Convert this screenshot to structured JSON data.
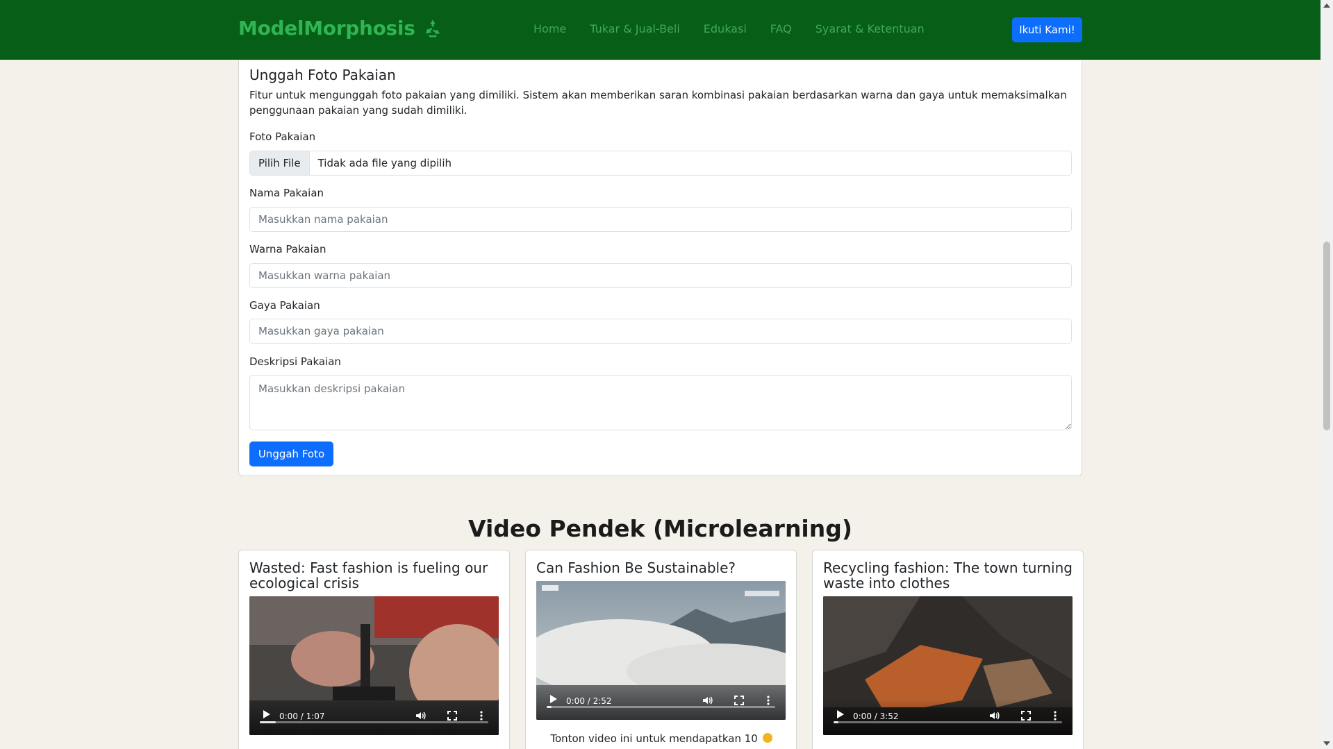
{
  "nav": {
    "brand": "ModelMorphosis",
    "links": [
      "Home",
      "Tukar & Jual-Beli",
      "Edukasi",
      "FAQ",
      "Syarat & Ketentuan"
    ],
    "cta": "Ikuti Kami!",
    "colors": {
      "background": "#075e16",
      "brand": "#2fb553",
      "link": "#41a75c",
      "cta": "#0d6efd"
    }
  },
  "upload": {
    "title": "Unggah Foto Pakaian",
    "description": "Fitur untuk mengunggah foto pakaian yang dimiliki. Sistem akan memberikan saran kombinasi pakaian berdasarkan warna dan gaya untuk memaksimalkan penggunaan pakaian yang sudah dimiliki.",
    "photo_label": "Foto Pakaian",
    "file_button": "Pilih File",
    "file_status": "Tidak ada file yang dipilih",
    "name_label": "Nama Pakaian",
    "name_placeholder": "Masukkan nama pakaian",
    "color_label": "Warna Pakaian",
    "color_placeholder": "Masukkan warna pakaian",
    "style_label": "Gaya Pakaian",
    "style_placeholder": "Masukkan gaya pakaian",
    "desc_label": "Deskripsi Pakaian",
    "desc_placeholder": "Masukkan deskripsi pakaian",
    "submit": "Unggah Foto"
  },
  "videos": {
    "section_title": "Video Pendek (Microlearning)",
    "items": [
      {
        "title": "Wasted: Fast fashion is fueling our ecological crisis",
        "time": "0:00 / 1:07",
        "progress": 0.07
      },
      {
        "title": "Can Fashion Be Sustainable?",
        "time": "0:00 / 2:52",
        "progress": 0.02,
        "caption": "Tonton video ini untuk mendapatkan 10"
      },
      {
        "title": "Recycling fashion: The town turning waste into clothes",
        "time": "0:00 / 3:52",
        "progress": 0.02
      }
    ]
  }
}
